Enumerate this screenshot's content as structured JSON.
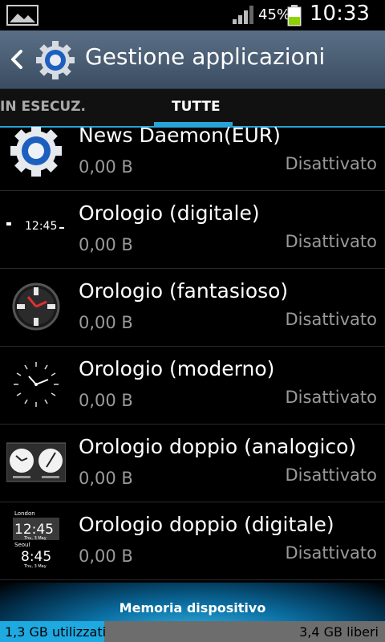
{
  "status_bar": {
    "gallery_icon": "gallery-icon",
    "signal_icon": "signal-icon",
    "battery_percent": "45%",
    "battery_level": 0.45,
    "time": "10:33"
  },
  "action_bar": {
    "back_icon": "back-icon",
    "app_icon": "settings-gear-icon",
    "title": "Gestione applicazioni"
  },
  "tabs": [
    {
      "label": "IN ESECUZ."
    },
    {
      "label": "TUTTE"
    }
  ],
  "apps": [
    {
      "name": "News Daemon(EUR)",
      "size": "0,00 B",
      "status": "Disattivato",
      "icon": "gear-icon"
    },
    {
      "name": "Orologio (digitale)",
      "size": "0,00 B",
      "status": "Disattivato",
      "icon": "digital-clock-icon"
    },
    {
      "name": "Orologio (fantasioso)",
      "size": "0,00 B",
      "status": "Disattivato",
      "icon": "fancy-clock-icon"
    },
    {
      "name": "Orologio (moderno)",
      "size": "0,00 B",
      "status": "Disattivato",
      "icon": "modern-clock-icon"
    },
    {
      "name": "Orologio doppio (analogico)",
      "size": "0,00 B",
      "status": "Disattivato",
      "icon": "dual-analog-clock-icon"
    },
    {
      "name": "Orologio doppio (digitale)",
      "size": "0,00 B",
      "status": "Disattivato",
      "icon": "dual-digital-clock-icon"
    }
  ],
  "icon_text": {
    "digital_time": "12:45",
    "dual_city_1": "London",
    "dual_time_1": "12:45",
    "dual_date_1": "Thu, 3 May",
    "dual_city_2": "Seoul",
    "dual_time_2": "8:45",
    "dual_date_2": "Thu, 3 May"
  },
  "storage": {
    "label": "Memoria dispositivo",
    "used": "1,3 GB utilizzati",
    "free": "3,4 GB liberi",
    "used_fraction": 0.27
  },
  "colors": {
    "accent": "#29a3d6",
    "action_bar": "#4b5f75",
    "storage_used": "#1fa9e1"
  }
}
